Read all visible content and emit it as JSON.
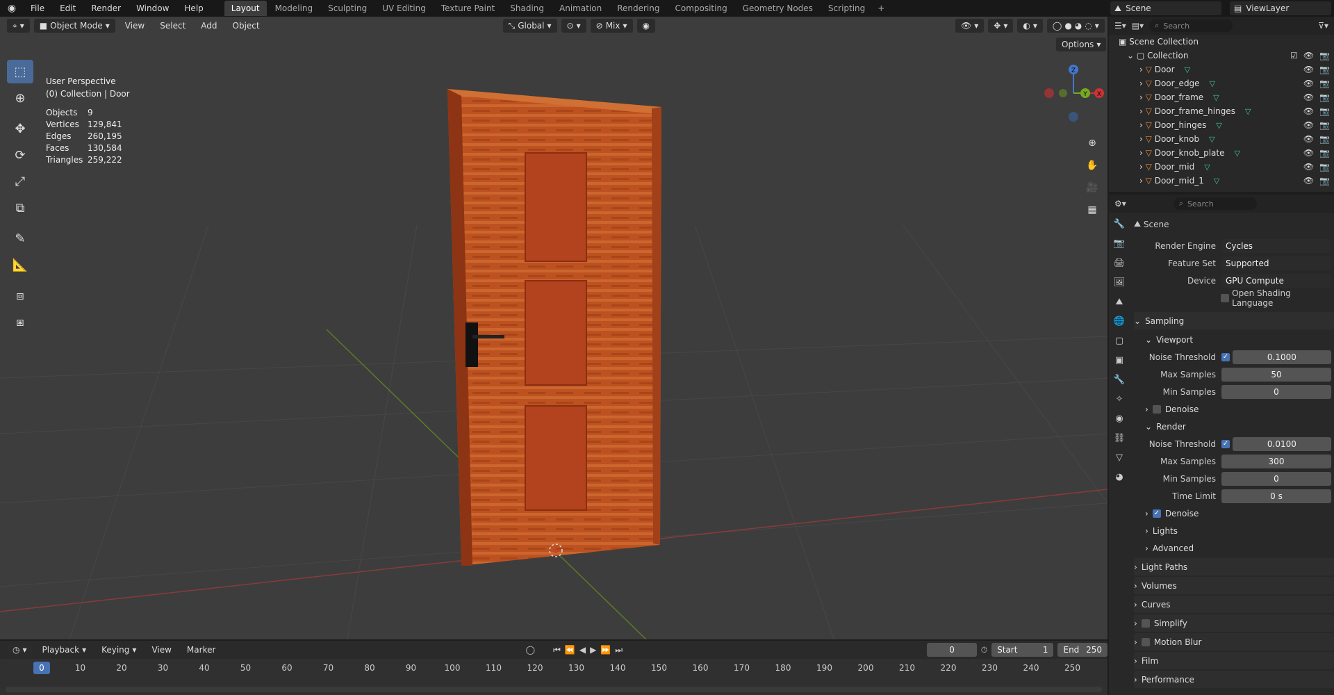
{
  "menu": [
    "File",
    "Edit",
    "Render",
    "Window",
    "Help"
  ],
  "workspaces": [
    "Layout",
    "Modeling",
    "Sculpting",
    "UV Editing",
    "Texture Paint",
    "Shading",
    "Animation",
    "Rendering",
    "Compositing",
    "Geometry Nodes",
    "Scripting"
  ],
  "active_workspace": "Layout",
  "scene_name": "Scene",
  "view_layer": "ViewLayer",
  "viewport": {
    "mode": "Object Mode",
    "menus": [
      "View",
      "Select",
      "Add",
      "Object"
    ],
    "orientation": "Global",
    "pivot": "Mix",
    "options": "Options",
    "perspective": "User Perspective",
    "collection_path": "(0) Collection | Door",
    "stats": [
      {
        "k": "Objects",
        "v": "9"
      },
      {
        "k": "Vertices",
        "v": "129,841"
      },
      {
        "k": "Edges",
        "v": "260,195"
      },
      {
        "k": "Faces",
        "v": "130,584"
      },
      {
        "k": "Triangles",
        "v": "259,222"
      }
    ],
    "axis": {
      "x": "X",
      "y": "Y",
      "z": "Z"
    }
  },
  "timeline": {
    "menus": [
      "Playback",
      "Keying",
      "View",
      "Marker"
    ],
    "current_frame": "0",
    "start_label": "Start",
    "start": "1",
    "end_label": "End",
    "end": "250",
    "ticks": [
      "0",
      "10",
      "20",
      "30",
      "40",
      "50",
      "60",
      "70",
      "80",
      "90",
      "100",
      "110",
      "120",
      "130",
      "140",
      "150",
      "160",
      "170",
      "180",
      "190",
      "200",
      "210",
      "220",
      "230",
      "240",
      "250"
    ]
  },
  "outliner": {
    "search_placeholder": "Search",
    "scene_collection": "Scene Collection",
    "collection": "Collection",
    "items": [
      "Door",
      "Door_edge",
      "Door_frame",
      "Door_frame_hinges",
      "Door_hinges",
      "Door_knob",
      "Door_knob_plate",
      "Door_mid",
      "Door_mid_1"
    ]
  },
  "properties": {
    "search_placeholder": "Search",
    "context": "Scene",
    "render_engine_label": "Render Engine",
    "render_engine": "Cycles",
    "feature_set_label": "Feature Set",
    "feature_set": "Supported",
    "device_label": "Device",
    "device": "GPU Compute",
    "osl_label": "Open Shading Language",
    "sampling": "Sampling",
    "viewport_label": "Viewport",
    "noise_threshold_label": "Noise Threshold",
    "vp_noise_threshold": "0.1000",
    "max_samples_label": "Max Samples",
    "vp_max_samples": "50",
    "min_samples_label": "Min Samples",
    "vp_min_samples": "0",
    "denoise_label": "Denoise",
    "render_label": "Render",
    "r_noise_threshold": "0.0100",
    "r_max_samples": "300",
    "r_min_samples": "0",
    "time_limit_label": "Time Limit",
    "r_time_limit": "0 s",
    "lights": "Lights",
    "advanced": "Advanced",
    "panels": [
      "Light Paths",
      "Volumes",
      "Curves",
      "Simplify",
      "Motion Blur",
      "Film",
      "Performance"
    ]
  }
}
